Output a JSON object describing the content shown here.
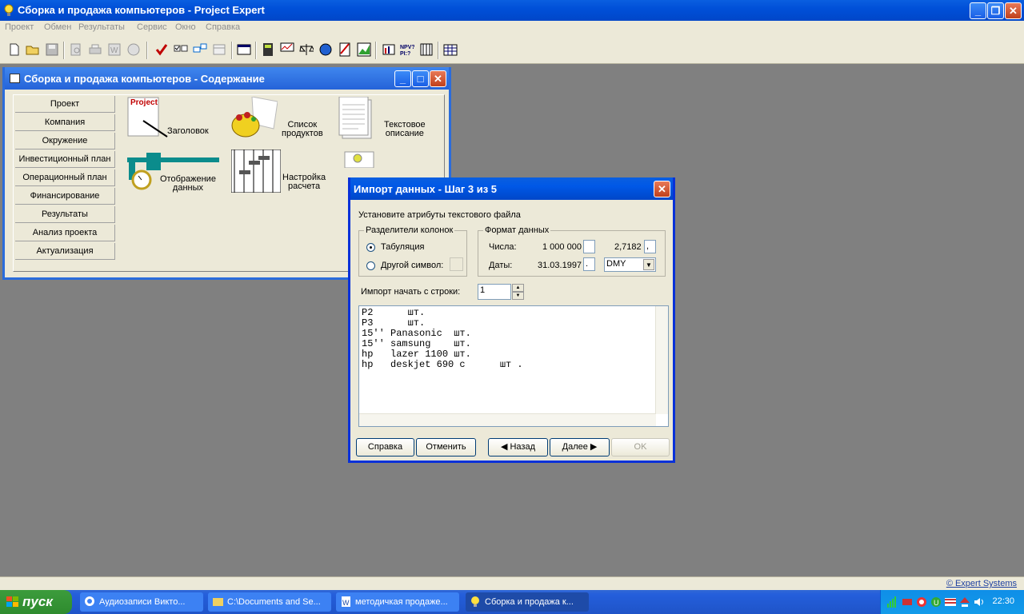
{
  "app": {
    "title": "Сборка и продажа компьютеров - Project Expert"
  },
  "menu": [
    "Проект",
    "Обмен",
    "Результаты",
    "Сервис",
    "Окно",
    "Справка"
  ],
  "content_window": {
    "title": "Сборка и продажа компьютеров - Содержание",
    "nav": [
      "Проект",
      "Компания",
      "Окружение",
      "Инвестиционный план",
      "Операционный план",
      "Финансирование",
      "Результаты",
      "Анализ проекта",
      "Актуализация"
    ],
    "icons": {
      "title_page": "Заголовок",
      "title_page_badge": "Project",
      "products_1": "Список",
      "products_2": "продуктов",
      "text_1": "Текстовое",
      "text_2": "описание",
      "display_1": "Отображение",
      "display_2": "данных",
      "calc_1": "Настройка",
      "calc_2": "расчета"
    }
  },
  "dialog": {
    "title": "Импорт данных - Шаг 3 из 5",
    "instruction": "Установите атрибуты текстового файла",
    "separators_label": "Разделители колонок",
    "tab_label": "Табуляция",
    "other_label": "Другой символ:",
    "format_label": "Формат данных",
    "numbers_label": "Числа:",
    "numbers_example": "1 000 000",
    "decimal_example": "2,7182",
    "decimal_sep": ",",
    "dates_label": "Даты:",
    "date_example": "31.03.1997",
    "date_sep": ".",
    "date_order": "DMY",
    "start_row_label": "Импорт начать с строки:",
    "start_row": "1",
    "preview": "P2      шт.\nP3      шт.\n15'' Panasonic  шт.\n15'' samsung    шт.\nhp   lazer 1100 шт.\nhp   deskjet 690 c      шт .",
    "buttons": {
      "help": "Справка",
      "cancel": "Отменить",
      "back": "Назад",
      "next": "Далее",
      "ok": "OK"
    }
  },
  "status": {
    "link": "© Expert Systems"
  },
  "taskbar": {
    "start": "пуск",
    "tasks": [
      "Аудиозаписи Викто...",
      "C:\\Documents and Se...",
      "методичкая продаже...",
      "Сборка и продажа к..."
    ],
    "clock": "22:30"
  }
}
